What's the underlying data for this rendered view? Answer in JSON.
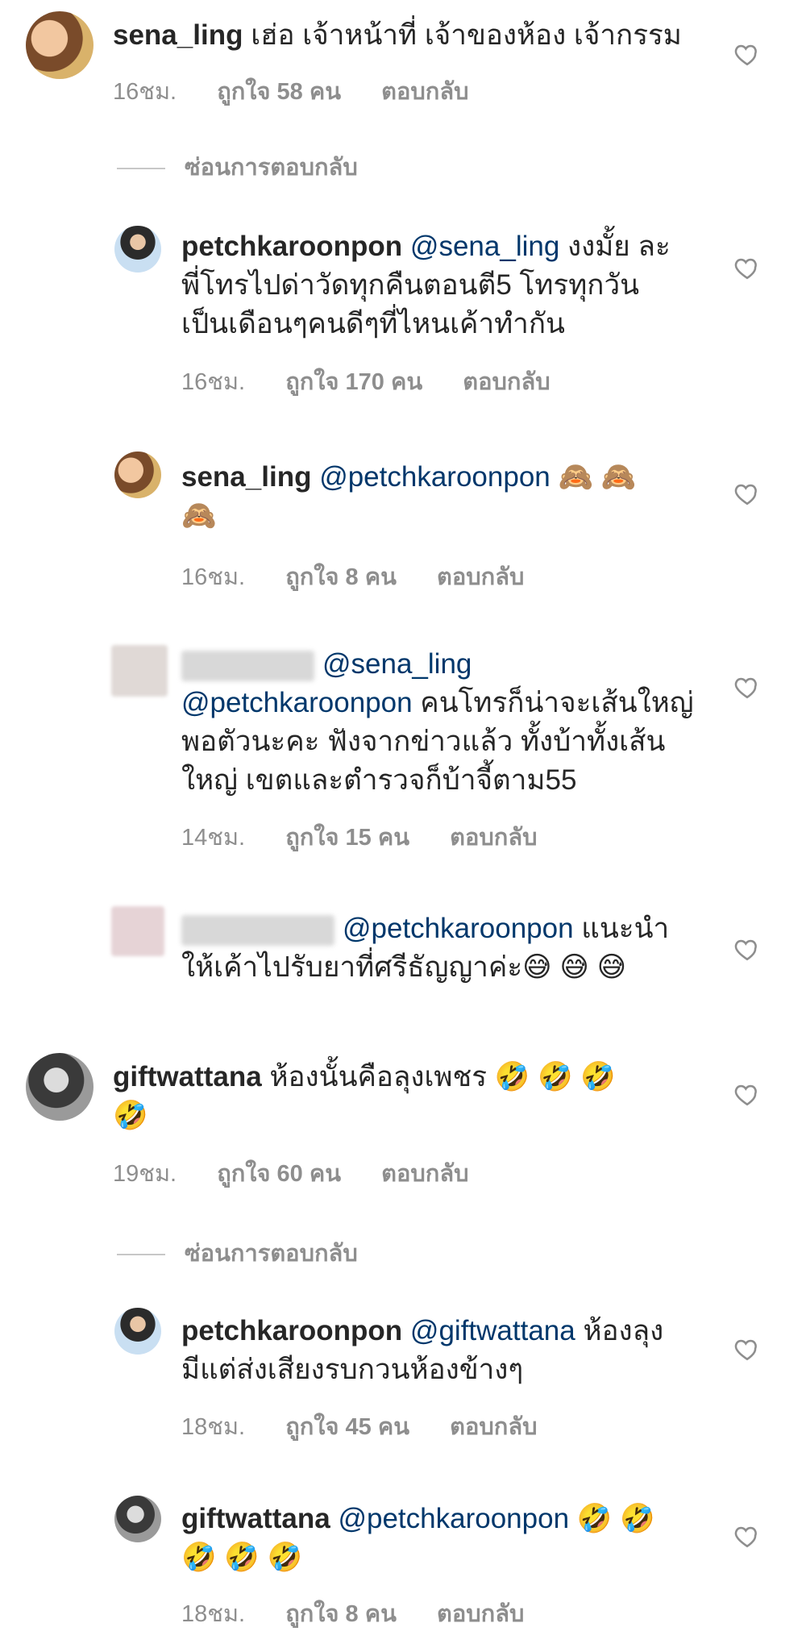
{
  "comments": [
    {
      "username": "sena_ling",
      "mention": "",
      "text": "เฮ่อ เจ้าหน้าที่ เจ้าของห้อง เจ้ากรรม",
      "time": "16ชม.",
      "likes": "ถูกใจ 58 คน",
      "reply": "ตอบกลับ"
    },
    {
      "username": "petchkaroonpon",
      "mention": "@sena_ling",
      "text": "งงมั้ย ละพี่โทรไปด่าวัดทุกคืนตอนตี5 โทรทุกวันเป็นเดือนๆคนดีๆที่ไหนเค้าทำกัน",
      "time": "16ชม.",
      "likes": "ถูกใจ 170 คน",
      "reply": "ตอบกลับ"
    },
    {
      "username": "sena_ling",
      "mention": "@petchkaroonpon",
      "text": "🙈 🙈 🙈",
      "time": "16ชม.",
      "likes": "ถูกใจ 8 คน",
      "reply": "ตอบกลับ"
    },
    {
      "username": "",
      "mention": "@sena_ling @petchkaroonpon",
      "text": "คนโทรก็น่าจะเส้นใหญ่พอตัวนะคะ ฟังจากข่าวแล้ว ทั้งบ้าทั้งเส้นใหญ่ เขตและตำรวจก็บ้าจี้ตาม55",
      "time": "14ชม.",
      "likes": "ถูกใจ 15 คน",
      "reply": "ตอบกลับ"
    },
    {
      "username": "",
      "mention": "@petchkaroonpon",
      "text": "แนะนำให้เค้าไปรับยาที่ศรีธัญญาค่ะ😅 😅 😅",
      "time": "",
      "likes": "",
      "reply": ""
    },
    {
      "username": "giftwattana",
      "mention": "",
      "text": "ห้องนั้นคือลุงเพชร 🤣 🤣 🤣 🤣",
      "time": "19ชม.",
      "likes": "ถูกใจ 60 คน",
      "reply": "ตอบกลับ"
    },
    {
      "username": "petchkaroonpon",
      "mention": "@giftwattana",
      "text": "ห้องลุงมีแต่ส่งเสียงรบกวนห้องข้างๆ",
      "time": "18ชม.",
      "likes": "ถูกใจ 45 คน",
      "reply": "ตอบกลับ"
    },
    {
      "username": "giftwattana",
      "mention": "@petchkaroonpon",
      "text": "🤣 🤣 🤣 🤣 🤣",
      "time": "18ชม.",
      "likes": "ถูกใจ 8 คน",
      "reply": "ตอบกลับ"
    }
  ],
  "hide_replies": "ซ่อนการตอบกลับ",
  "colors": {
    "text": "#262626",
    "mention": "#00376b",
    "meta": "#8e8e8e"
  },
  "icons": [
    "heart-icon"
  ]
}
